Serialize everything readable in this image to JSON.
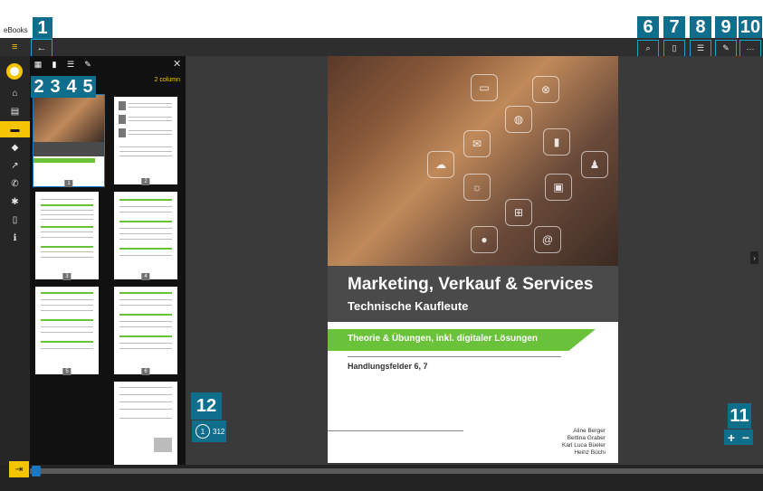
{
  "window": {
    "title": "eBooks"
  },
  "rail": {
    "items": [
      {
        "icon": "home-icon",
        "glyph": "⌂"
      },
      {
        "icon": "library-icon",
        "glyph": "▤"
      },
      {
        "icon": "book-icon",
        "glyph": "▬",
        "active": true
      },
      {
        "icon": "tag-icon",
        "glyph": "◆"
      },
      {
        "icon": "external-link-icon",
        "glyph": "↗"
      },
      {
        "icon": "phone-icon",
        "glyph": "✆"
      },
      {
        "icon": "settings-icon",
        "glyph": "✱"
      },
      {
        "icon": "device-icon",
        "glyph": "▯"
      },
      {
        "icon": "info-icon",
        "glyph": "ℹ"
      }
    ]
  },
  "panel": {
    "columns_label": "2 column",
    "tools": [
      {
        "icon": "thumbnails-icon",
        "glyph": "▦"
      },
      {
        "icon": "bookmark-icon",
        "glyph": "▮"
      },
      {
        "icon": "toc-icon",
        "glyph": "☰"
      },
      {
        "icon": "pen-icon",
        "glyph": "✎"
      }
    ],
    "close_glyph": "✕",
    "pages": [
      "1",
      "2",
      "3",
      "4",
      "5",
      "6"
    ]
  },
  "toolbar": {
    "back_glyph": "←",
    "buttons": [
      {
        "icon": "search-icon",
        "glyph": "⌕"
      },
      {
        "icon": "page-icon",
        "glyph": "▯"
      },
      {
        "icon": "list-icon",
        "glyph": "☰"
      },
      {
        "icon": "edit-icon",
        "glyph": "✎"
      },
      {
        "icon": "more-icon",
        "glyph": "···"
      }
    ]
  },
  "callouts": [
    "1",
    "2",
    "3",
    "4",
    "5",
    "6",
    "7",
    "8",
    "9",
    "10",
    "11",
    "12"
  ],
  "book": {
    "title": "Marketing, Verkauf & Services",
    "subtitle": "Technische Kaufleute",
    "tagline": "Theorie & Übungen, inkl. digitaler Lösungen",
    "fields": "Handlungsfelder 6, 7",
    "authors": [
      "Aline Berger",
      "Bettina Graber",
      "Karl Luca Büeler",
      "Heinz Büchi"
    ]
  },
  "page_indicator": {
    "current": "1",
    "total": "312"
  },
  "zoom": {
    "plus": "+",
    "minus": "−"
  },
  "colors": {
    "accent_yellow": "#f5c400",
    "callout_teal": "#0f6e8c",
    "green": "#6ac13a",
    "border_cyan": "#1aa6c8"
  }
}
